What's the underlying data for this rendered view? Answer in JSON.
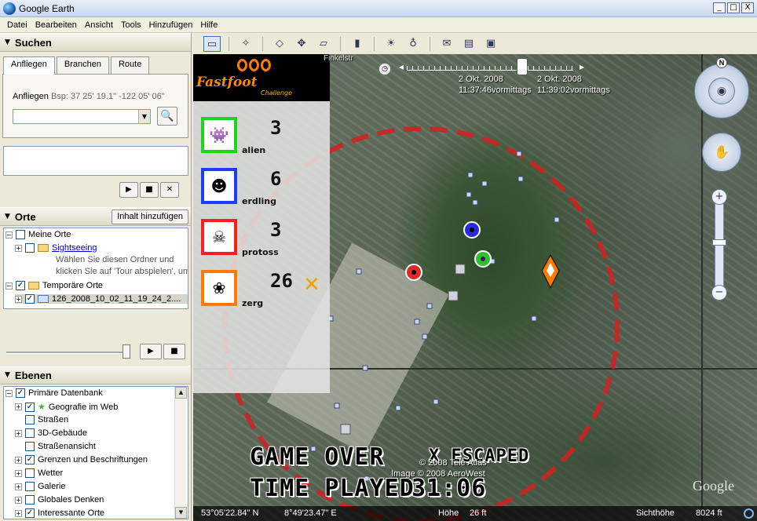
{
  "window": {
    "title": "Google Earth",
    "minimize": "_",
    "maximize": "□",
    "close": "X"
  },
  "menu": [
    "Datei",
    "Bearbeiten",
    "Ansicht",
    "Tools",
    "Hinzufügen",
    "Hilfe"
  ],
  "search": {
    "header": "Suchen",
    "tabs": [
      "Anfliegen",
      "Branchen",
      "Route"
    ],
    "fly_label": "Anfliegen",
    "fly_hint": "Bsp: 37 25' 19.1\" -122 05' 06\"",
    "fly_value": ""
  },
  "places": {
    "header": "Orte",
    "add_button": "Inhalt hinzufügen",
    "my_places": "Meine Orte",
    "sightseeing": "Sightseeing",
    "sightseeing_note_1": "Wählen Sie diesen Ordner und",
    "sightseeing_note_2": "klicken Sie auf 'Tour abspielen', um",
    "temp_places": "Temporäre Orte",
    "kml_file": "126_2008_10_02_11_19_24_2...."
  },
  "layers": {
    "header": "Ebenen",
    "items": [
      {
        "label": "Primäre Datenbank",
        "checked": true
      },
      {
        "label": "Geografie im Web",
        "checked": true
      },
      {
        "label": "Straßen",
        "checked": false
      },
      {
        "label": "3D-Gebäude",
        "checked": false
      },
      {
        "label": "Straßenansicht",
        "checked": false
      },
      {
        "label": "Grenzen und Beschriftungen",
        "checked": true
      },
      {
        "label": "Wetter",
        "checked": false
      },
      {
        "label": "Galerie",
        "checked": false
      },
      {
        "label": "Globales Denken",
        "checked": false
      },
      {
        "label": "Interessante Orte",
        "checked": true
      }
    ]
  },
  "game": {
    "logo_text": "Fastfoot",
    "logo_sub": "Challenge",
    "teams": [
      {
        "name": "alien",
        "count": "3",
        "color": "#1ed41e"
      },
      {
        "name": "erdling",
        "count": "6",
        "color": "#1e3cff"
      },
      {
        "name": "protoss",
        "count": "3",
        "color": "#ff1e1e"
      },
      {
        "name": "zerg",
        "count": "26",
        "color": "#ff7a00"
      }
    ],
    "game_over": "GAME OVER",
    "x_escaped": "X ESCAPED",
    "time_played_label": "TIME PLAYED",
    "time_played": "31:06"
  },
  "timeline": {
    "date_start": "2 Okt. 2008",
    "time_start": "11:37:46vormittags",
    "date_end": "2 Okt. 2008",
    "time_end": "11:39:02vormittags"
  },
  "map": {
    "nav_north": "N",
    "zoom_in": "+",
    "zoom_out": "−",
    "credit_1": "© 2008 Tele Atlas",
    "credit_2": "Image © 2008 AeroWest",
    "google": "Google",
    "top_label": "Finkelstr"
  },
  "status": {
    "lat": "53°05'22.84\" N",
    "lon": "8°49'23.47\" E",
    "elev_label": "Höhe",
    "elev": "26 ft",
    "eye_label": "Sichthöhe",
    "eye": "8024 ft"
  }
}
